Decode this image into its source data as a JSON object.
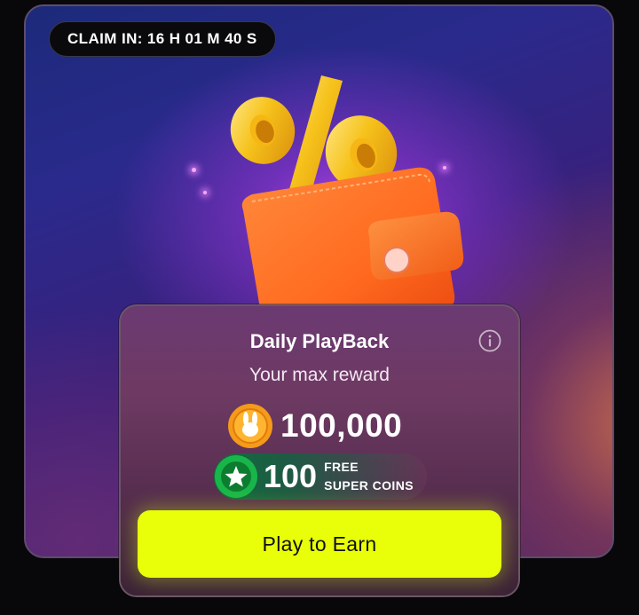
{
  "timer": {
    "text": "CLAIM IN: 16 H 01 M 40 S"
  },
  "panel": {
    "title": "Daily PlayBack",
    "subtitle": "Your max reward",
    "info_icon": "info-icon",
    "reward": {
      "icon": "bunny-coin-icon",
      "amount": "100,000"
    },
    "super_coins": {
      "icon": "star-badge-icon",
      "amount": "100",
      "label_line1": "FREE",
      "label_line2": "SUPER COINS"
    }
  },
  "cta": {
    "label": "Play to Earn"
  },
  "colors": {
    "cta_background": "#e8ff09",
    "card_background": "#2a2a8c",
    "accent_purple": "#b044e6",
    "wallet_orange": "#ff6a1f",
    "percent_gold": "#f6c21b"
  }
}
